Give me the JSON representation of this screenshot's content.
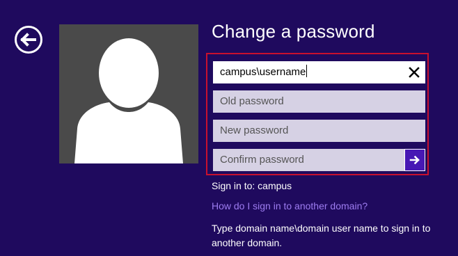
{
  "screen": {
    "title": "Change a password"
  },
  "colors": {
    "background": "#1f0a5e",
    "field_inactive": "#d6d1e4",
    "focus_highlight": "#c8102e",
    "submit_button": "#4617b4",
    "link": "#9d7cf0"
  },
  "form": {
    "username_value": "campus\\username",
    "old_password_placeholder": "Old password",
    "new_password_placeholder": "New password",
    "confirm_password_placeholder": "Confirm password"
  },
  "icons": {
    "back": "back-arrow-icon",
    "clear": "close-icon",
    "submit": "arrow-right-icon",
    "avatar": "user-silhouette-icon"
  },
  "footer": {
    "sign_in_to": "Sign in to: campus",
    "help_link": "How do I sign in to another domain?",
    "info": "Type domain name\\domain user name to sign in to another domain."
  }
}
